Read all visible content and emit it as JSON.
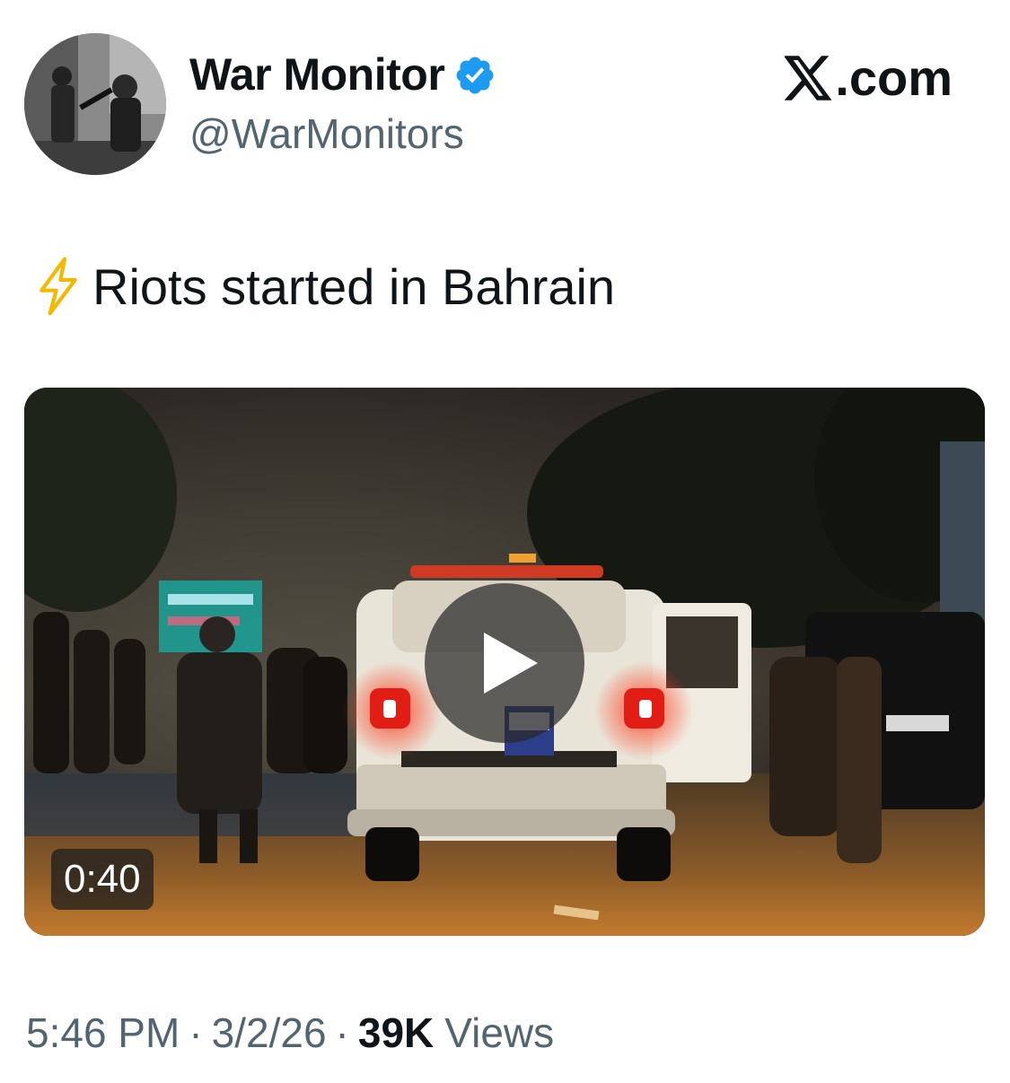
{
  "author": {
    "display_name": "War Monitor",
    "handle": "@WarMonitors",
    "verified": true,
    "avatar": "avatar-photo"
  },
  "brand": {
    "logo_icon": "x-logo-icon",
    "label": ".com"
  },
  "tweet": {
    "emoji_icon": "high-voltage-emoji-icon",
    "text": "Riots started in Bahrain"
  },
  "media": {
    "type": "video",
    "duration": "0:40",
    "play_icon": "play-icon"
  },
  "meta": {
    "time": "5:46 PM",
    "separator": "·",
    "date": "3/2/26",
    "views_count": "39K",
    "views_label": "Views"
  },
  "colors": {
    "verified_badge": "#1d9bf0",
    "text_primary": "#0f1419",
    "text_secondary": "#536471",
    "emoji_bolt": "#f5b800"
  }
}
